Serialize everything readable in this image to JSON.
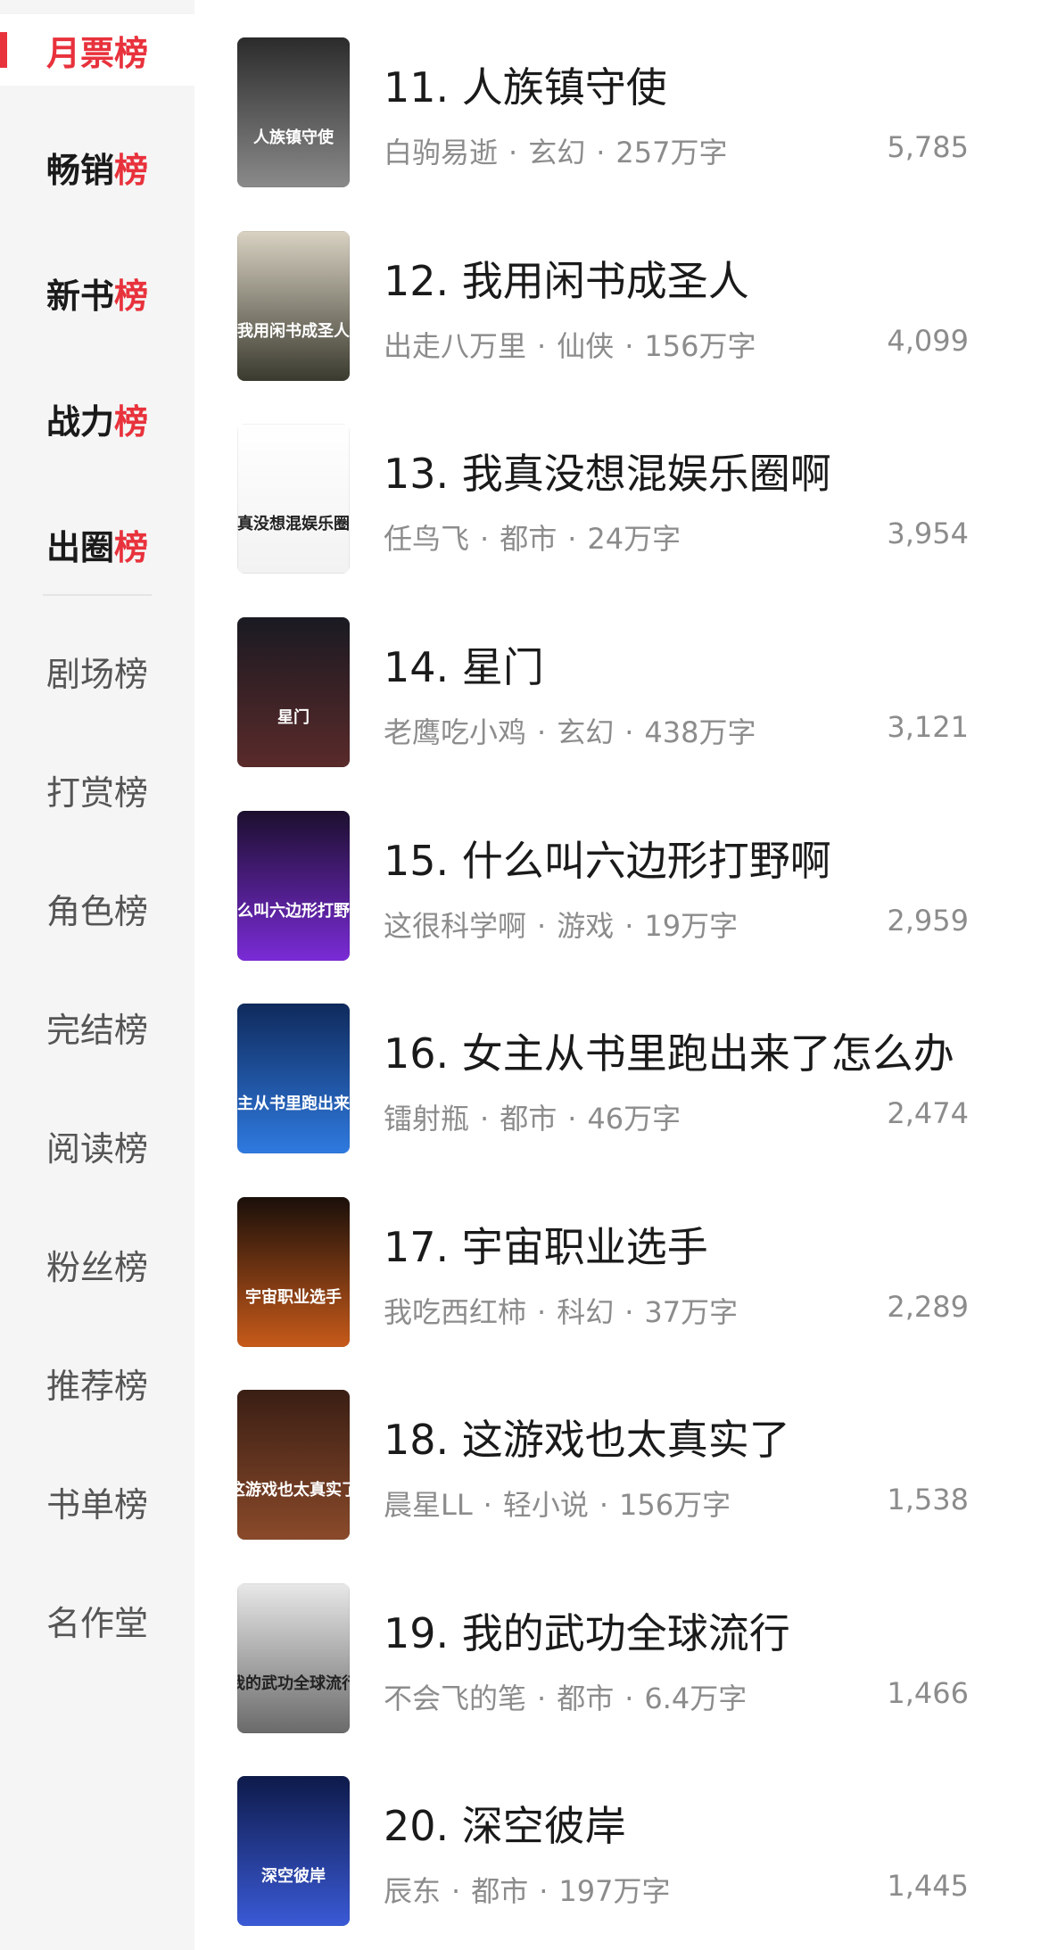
{
  "sidebar": {
    "primary": [
      {
        "head": "月票",
        "tail": "榜",
        "active": true
      },
      {
        "head": "畅销",
        "tail": "榜"
      },
      {
        "head": "新书",
        "tail": "榜"
      },
      {
        "head": "战力",
        "tail": "榜"
      },
      {
        "head": "出圈",
        "tail": "榜"
      }
    ],
    "secondary": [
      "剧场榜",
      "打赏榜",
      "角色榜",
      "完结榜",
      "阅读榜",
      "粉丝榜",
      "推荐榜",
      "书单榜",
      "名作堂"
    ]
  },
  "books": [
    {
      "rank": "11.",
      "title": "人族镇守使",
      "author": "白驹易逝",
      "genre": "玄幻",
      "words": "257万字",
      "count": "5,785",
      "cover_colors": [
        "#2b2b2b",
        "#8a8a8a"
      ],
      "cover_text": "人族镇守使"
    },
    {
      "rank": "12.",
      "title": "我用闲书成圣人",
      "author": "出走八万里",
      "genre": "仙侠",
      "words": "156万字",
      "count": "4,099",
      "cover_colors": [
        "#d9d2c3",
        "#3a3a2e"
      ],
      "cover_text": "我用闲书成圣人"
    },
    {
      "rank": "13.",
      "title": "我真没想混娱乐圈啊",
      "author": "任鸟飞",
      "genre": "都市",
      "words": "24万字",
      "count": "3,954",
      "cover_colors": [
        "#ffffff",
        "#f2f2f2"
      ],
      "cover_text": "我真没想混娱乐圈啊"
    },
    {
      "rank": "14.",
      "title": "星门",
      "author": "老鹰吃小鸡",
      "genre": "玄幻",
      "words": "438万字",
      "count": "3,121",
      "cover_colors": [
        "#1a1a22",
        "#5a2a2a"
      ],
      "cover_text": "星门"
    },
    {
      "rank": "15.",
      "title": "什么叫六边形打野啊",
      "author": "这很科学啊",
      "genre": "游戏",
      "words": "19万字",
      "count": "2,959",
      "cover_colors": [
        "#1c0f2e",
        "#7a2bd6"
      ],
      "cover_text": "什么叫六边形打野啊"
    },
    {
      "rank": "16.",
      "title": "女主从书里跑出来了怎么办",
      "author": "镭射瓶",
      "genre": "都市",
      "words": "46万字",
      "count": "2,474",
      "cover_colors": [
        "#0f2a5c",
        "#2f7ae0"
      ],
      "cover_text": "女主从书里跑出来了"
    },
    {
      "rank": "17.",
      "title": "宇宙职业选手",
      "author": "我吃西红柿",
      "genre": "科幻",
      "words": "37万字",
      "count": "2,289",
      "cover_colors": [
        "#1a0f0a",
        "#c75a1a"
      ],
      "cover_text": "宇宙职业选手"
    },
    {
      "rank": "18.",
      "title": "这游戏也太真实了",
      "author": "晨星LL",
      "genre": "轻小说",
      "words": "156万字",
      "count": "1,538",
      "cover_colors": [
        "#3a1e14",
        "#8a4a2a"
      ],
      "cover_text": "这游戏也太真实了"
    },
    {
      "rank": "19.",
      "title": "我的武功全球流行",
      "author": "不会飞的笔",
      "genre": "都市",
      "words": "6.4万字",
      "count": "1,466",
      "cover_colors": [
        "#e8e8e8",
        "#6a6a6a"
      ],
      "cover_text": "我的武功全球流行"
    },
    {
      "rank": "20.",
      "title": "深空彼岸",
      "author": "辰东",
      "genre": "都市",
      "words": "197万字",
      "count": "1,445",
      "cover_colors": [
        "#0e1a4a",
        "#3a5ad6"
      ],
      "cover_text": "深空彼岸"
    }
  ]
}
